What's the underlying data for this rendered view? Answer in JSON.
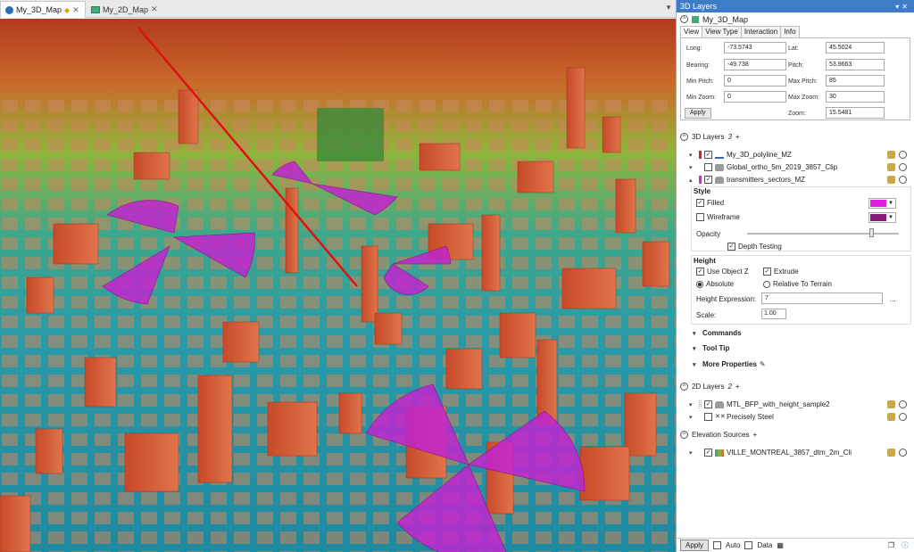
{
  "tabs": [
    {
      "label": "My_3D_Map"
    },
    {
      "label": "My_2D_Map"
    }
  ],
  "panel": {
    "title": "3D Layers",
    "map_name": "My_3D_Map",
    "sub_tabs": [
      "View",
      "View Type",
      "Interaction",
      "Info"
    ],
    "view": {
      "long_label": "Long:",
      "long": "-73.5743",
      "lat_label": "Lat:",
      "lat": "45.5024",
      "bearing_label": "Bearing:",
      "bearing": "-49.738",
      "pitch_label": "Pitch:",
      "pitch": "53.9663",
      "min_pitch_label": "Min Pitch:",
      "min_pitch": "0",
      "max_pitch_label": "Max Pitch:",
      "max_pitch": "85",
      "min_zoom_label": "Min Zoom:",
      "min_zoom": "0",
      "max_zoom_label": "Max Zoom:",
      "max_zoom": "30",
      "zoom_label": "Zoom:",
      "zoom": "15.5481",
      "apply": "Apply"
    },
    "layers3d": {
      "title": "3D Layers",
      "count": "3",
      "items": [
        {
          "name": "My_3D_polyline_MZ",
          "color": "#e02020"
        },
        {
          "name": "Global_ortho_5m_2019_3857_Clip",
          "color": ""
        },
        {
          "name": "transmitters_sectors_MZ",
          "color": "#e020e0"
        }
      ]
    },
    "style": {
      "title": "Style",
      "filled": "Filled",
      "filled_color": "#e020e0",
      "wireframe": "Wireframe",
      "wire_color": "#8a1a7a",
      "opacity": "Opacity",
      "opacity_value": 0.82,
      "depth": "Depth Testing"
    },
    "height": {
      "title": "Height",
      "use_z": "Use Object Z",
      "extrude": "Extrude",
      "absolute": "Absolute",
      "relative": "Relative To Terrain",
      "expr_label": "Height Expression:",
      "expr": "7",
      "more": "...",
      "scale_label": "Scale:",
      "scale": "1.00"
    },
    "collapsed": [
      "Commands",
      "Tool Tip",
      "More Properties"
    ],
    "layers2d": {
      "title": "2D Layers",
      "count": "2",
      "items": [
        {
          "name": "MTL_BFP_with_height_sample2"
        },
        {
          "name": "Precisely Steel"
        }
      ]
    },
    "elevation": {
      "title": "Elevation Sources",
      "items": [
        {
          "name": "VILLE_MONTREAL_3857_dtm_2m_Cli"
        }
      ]
    },
    "bottom": {
      "apply": "Apply",
      "auto": "Auto",
      "data": "Data"
    }
  },
  "colors": {
    "accent": "#3d7dc7",
    "sector": "#c025d0",
    "building": "#d4603a"
  }
}
